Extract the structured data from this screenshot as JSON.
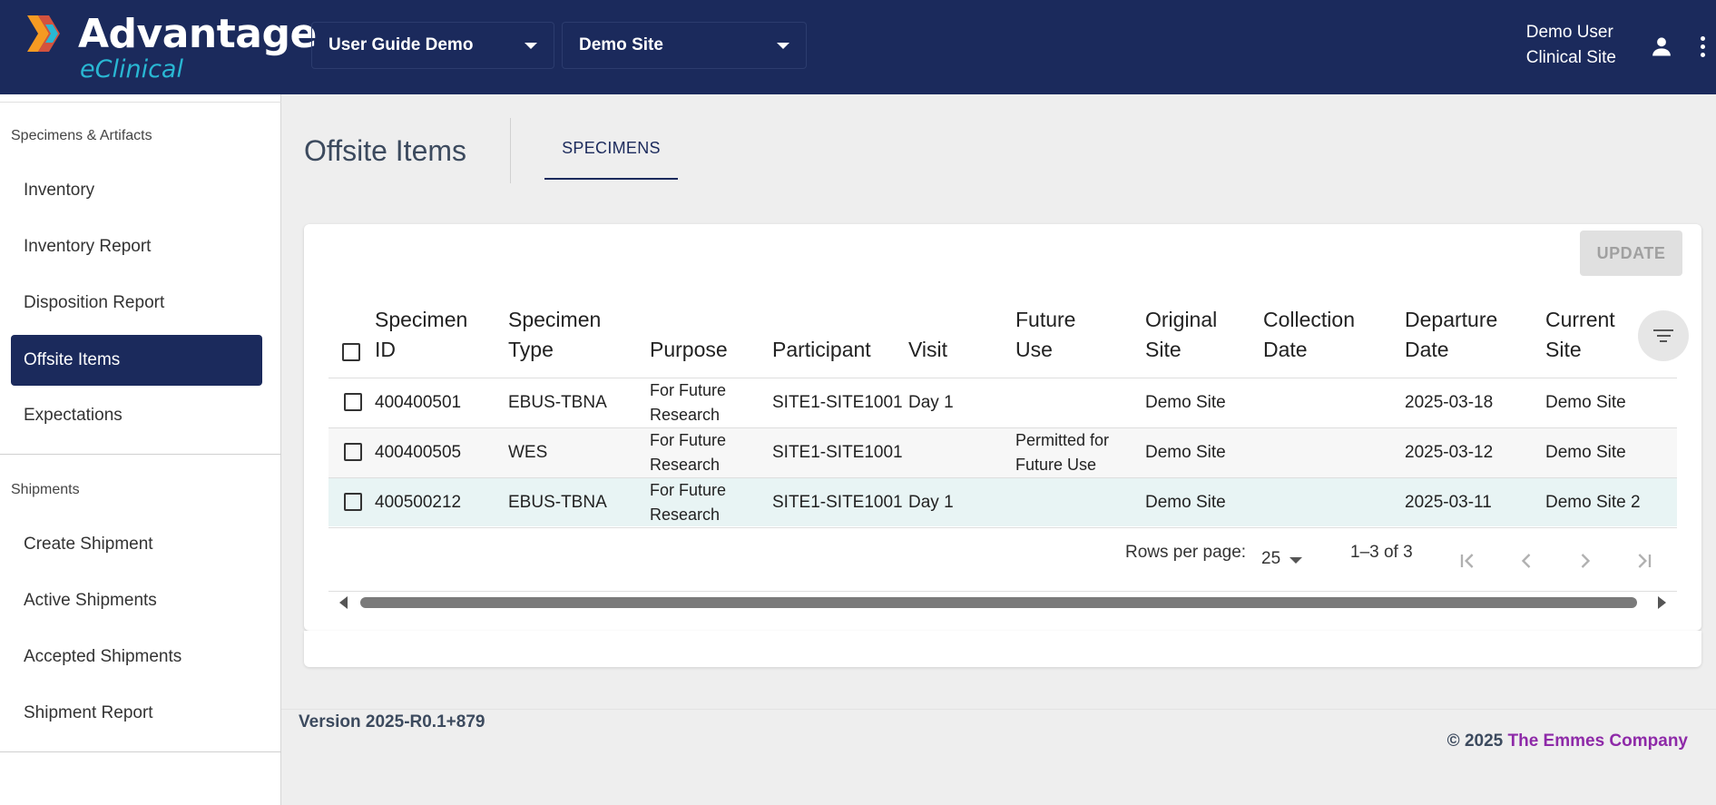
{
  "header": {
    "logo_title": "Advantage",
    "logo_sub": "eClinical",
    "study_select": "User Guide Demo",
    "site_select": "Demo Site",
    "user_name": "Demo User",
    "user_role": "Clinical Site",
    "user_icon": "person-icon",
    "menu_icon": "more-vert-icon"
  },
  "sidebar": {
    "section1": "Specimens & Artifacts",
    "items1": [
      {
        "label": "Inventory"
      },
      {
        "label": "Inventory Report"
      },
      {
        "label": "Disposition Report"
      },
      {
        "label": "Offsite Items",
        "active": true
      },
      {
        "label": "Expectations"
      }
    ],
    "section2": "Shipments",
    "items2": [
      {
        "label": "Create Shipment"
      },
      {
        "label": "Active Shipments"
      },
      {
        "label": "Accepted Shipments"
      },
      {
        "label": "Shipment Report"
      }
    ]
  },
  "main": {
    "title": "Offsite Items",
    "tab": "SPECIMENS",
    "update_button": "UPDATE",
    "columns": [
      [
        "Specimen",
        "ID"
      ],
      [
        "Specimen",
        "Type"
      ],
      [
        "",
        "Purpose"
      ],
      [
        "",
        "Participant"
      ],
      [
        "",
        "Visit"
      ],
      [
        "Future",
        "Use"
      ],
      [
        "Original",
        "Site"
      ],
      [
        "Collection",
        "Date"
      ],
      [
        "Departure",
        "Date"
      ],
      [
        "Current",
        "Site"
      ]
    ],
    "rows": [
      {
        "id": "400400501",
        "type": "EBUS-TBNA",
        "purpose1": "For Future",
        "purpose2": "Research",
        "participant": "SITE1-SITE1001",
        "visit": "Day 1",
        "future1": "",
        "future2": "",
        "orig": "Demo Site",
        "collection": "",
        "departure": "2025-03-18",
        "current": "Demo Site"
      },
      {
        "id": "400400505",
        "type": "WES",
        "purpose1": "For Future",
        "purpose2": "Research",
        "participant": "SITE1-SITE1001",
        "visit": "",
        "future1": "Permitted for",
        "future2": "Future Use",
        "orig": "Demo Site",
        "collection": "",
        "departure": "2025-03-12",
        "current": "Demo Site"
      },
      {
        "id": "400500212",
        "type": "EBUS-TBNA",
        "purpose1": "For Future",
        "purpose2": "Research",
        "participant": "SITE1-SITE1001",
        "visit": "Day 1",
        "future1": "",
        "future2": "",
        "orig": "Demo Site",
        "collection": "",
        "departure": "2025-03-11",
        "current": "Demo Site 2"
      }
    ],
    "pagination": {
      "rows_label": "Rows per page:",
      "rows_value": "25",
      "range": "1–3 of 3"
    }
  },
  "footer": {
    "version": "Version 2025-R0.1+879",
    "copyright": "© 2025",
    "company": "The Emmes Company"
  },
  "colors": {
    "header_bg": "#1b2a5c",
    "accent_cyan": "#29b7d3",
    "company_purple": "#8e2aa8",
    "highlight_row": "#e8f4f4"
  }
}
